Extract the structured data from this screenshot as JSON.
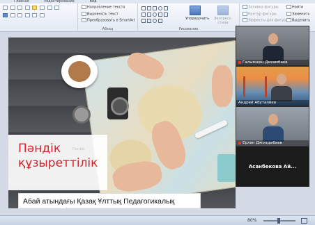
{
  "menubar": {
    "items": [
      "Главная",
      "Редактирование",
      "Вид"
    ]
  },
  "ribbon": {
    "paragraph": {
      "caption": "Абзац",
      "text_direction": "Направление текста",
      "align_text": "Выровнять текст",
      "smartart": "Преобразовать в SmartArt"
    },
    "drawing": {
      "caption": "Рисование",
      "arrange": "Упорядочить",
      "quick_styles": "Экспресс-стили",
      "shape_fill": "Заливка фигуры",
      "shape_outline": "Контур фигуры",
      "shape_effects": "Эффекты для фигур"
    },
    "editing": {
      "find": "Найти",
      "replace": "Заменить",
      "select": "Выделить"
    }
  },
  "slide": {
    "title": "Пәндік құзыреттілік",
    "ghost_label": "Пәндік",
    "caption": "Абай атындағы Қазақ Ұлттық Педагогикалық Университеті."
  },
  "video_tiles": [
    {
      "name": "Галымжан Дихамбаев"
    },
    {
      "name": "Андрей Абуталиев"
    },
    {
      "name": "Ерлан Джолдыбаев"
    },
    {
      "name": "Асанбекова Ай..."
    }
  ],
  "statusbar": {
    "zoom": "80%"
  },
  "colors": {
    "title_red": "#d2232a",
    "ribbon_bg": "#e3eaf4",
    "video_bg": "#1c1c1c"
  }
}
